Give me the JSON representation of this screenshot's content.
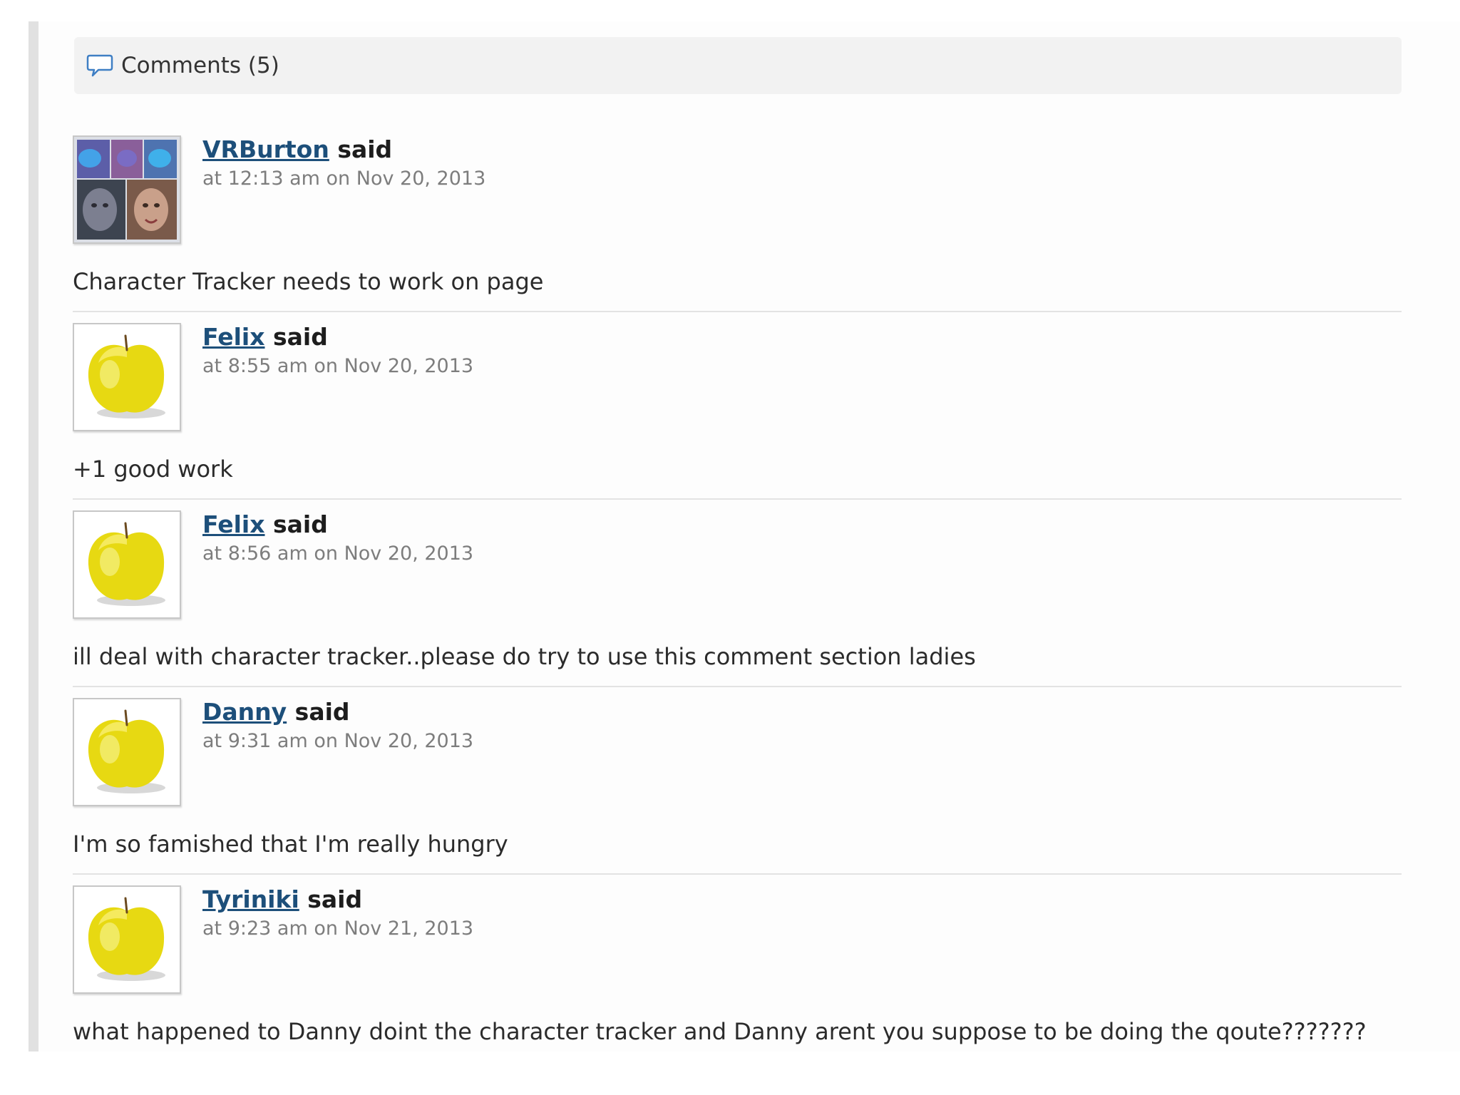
{
  "header": {
    "icon": "speech-bubble-icon",
    "title": "Comments (5)"
  },
  "colors": {
    "link": "#1d4f7a",
    "timestamp": "#7d7d7d",
    "header_bg": "#f2f2f2"
  },
  "comments": [
    {
      "author": "VRBurton",
      "said": "said",
      "timestamp": "at 12:13 am on Nov 20, 2013",
      "avatar": "photo-collage-avatar",
      "body": "Character Tracker needs to work on page"
    },
    {
      "author": "Felix",
      "said": "said",
      "timestamp": "at 8:55 am on Nov 20, 2013",
      "avatar": "apple-avatar",
      "body": "+1 good work"
    },
    {
      "author": "Felix",
      "said": "said",
      "timestamp": "at 8:56 am on Nov 20, 2013",
      "avatar": "apple-avatar",
      "body": "ill deal with character tracker..please do try to use this comment section ladies"
    },
    {
      "author": "Danny",
      "said": "said",
      "timestamp": "at 9:31 am on Nov 20, 2013",
      "avatar": "apple-avatar",
      "body": "I'm so famished that I'm really hungry"
    },
    {
      "author": "Tyriniki",
      "said": "said",
      "timestamp": "at 9:23 am on Nov 21, 2013",
      "avatar": "apple-avatar",
      "body": "what happened to Danny doint the character tracker and Danny arent you suppose to be doing the qoute???????"
    }
  ]
}
